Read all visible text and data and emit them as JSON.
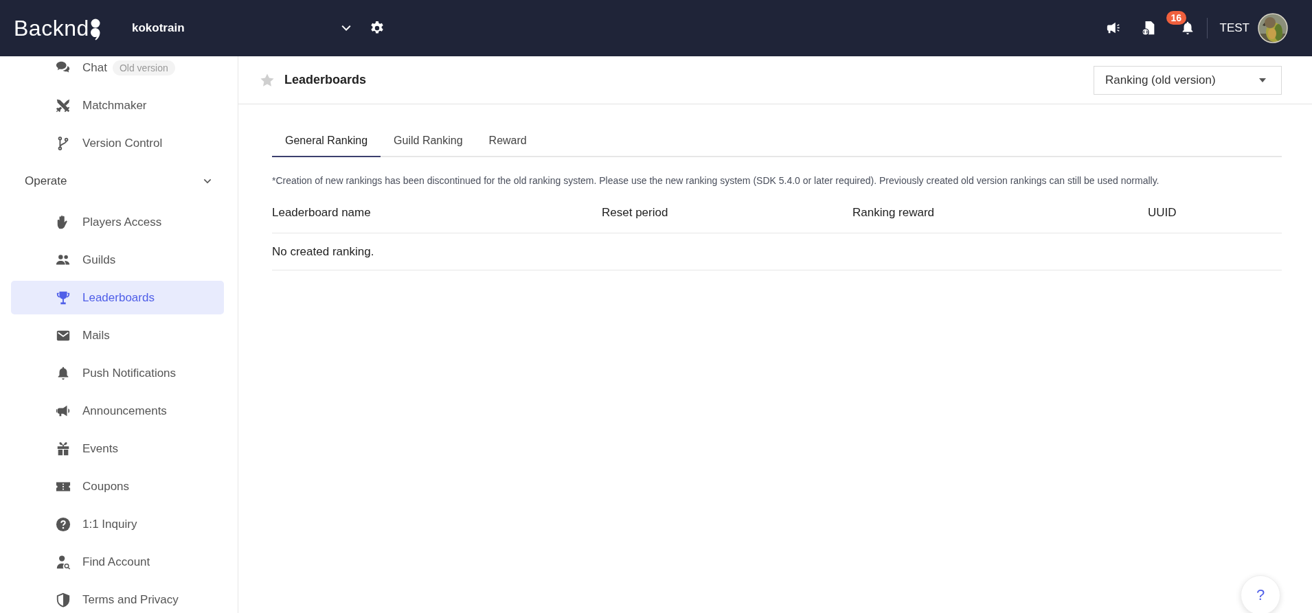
{
  "header": {
    "logo": "Backnd",
    "project": "kokotrain",
    "notification_count": "16",
    "user": "TEST"
  },
  "sidebar": {
    "sections": [
      {
        "items": [
          {
            "label": "Chat",
            "badge": "Old version",
            "selected": false
          },
          {
            "label": "Matchmaker",
            "selected": false
          },
          {
            "label": "Version Control",
            "selected": false
          }
        ]
      },
      {
        "title": "Operate",
        "expanded": true,
        "items": [
          {
            "label": "Players Access",
            "selected": false
          },
          {
            "label": "Guilds",
            "selected": false
          },
          {
            "label": "Leaderboards",
            "selected": true
          },
          {
            "label": "Mails",
            "selected": false
          },
          {
            "label": "Push Notifications",
            "selected": false
          },
          {
            "label": "Announcements",
            "selected": false
          },
          {
            "label": "Events",
            "selected": false
          },
          {
            "label": "Coupons",
            "selected": false
          },
          {
            "label": "1:1 Inquiry",
            "selected": false
          },
          {
            "label": "Find Account",
            "selected": false
          },
          {
            "label": "Terms and Privacy",
            "selected": false
          }
        ]
      }
    ]
  },
  "page": {
    "title": "Leaderboards",
    "favorite": false,
    "version_select": "Ranking (old version)"
  },
  "tabs": [
    {
      "label": "General Ranking",
      "selected": true
    },
    {
      "label": "Guild Ranking",
      "selected": false
    },
    {
      "label": "Reward",
      "selected": false
    }
  ],
  "notice": "*Creation of new rankings has been discontinued for the old ranking system. Please use the new ranking system (SDK 5.4.0 or later required). Previously created old version rankings can still be used normally.",
  "table": {
    "columns": [
      "Leaderboard name",
      "Reset period",
      "Ranking reward",
      "UUID"
    ],
    "empty_text": "No created ranking."
  },
  "help_button": "?"
}
